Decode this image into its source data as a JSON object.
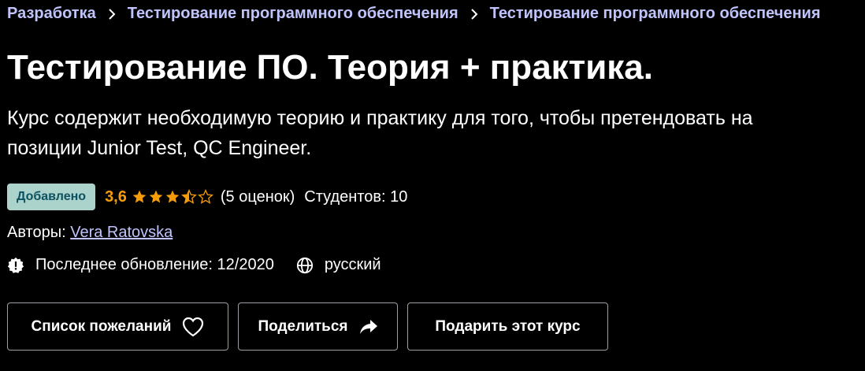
{
  "breadcrumb": {
    "items": [
      "Разработка",
      "Тестирование программного обеспечения",
      "Тестирование программного обеспечения"
    ],
    "separator_icon": "chevron-right-icon"
  },
  "course": {
    "title": "Тестирование ПО. Теория + практика.",
    "subtitle": "Курс содержит необходимую теорию и практику для того, чтобы претендовать на позиции Junior Test, QC Engineer.",
    "badge": "Добавлено",
    "rating_value": "3,6",
    "rating_stars": 3.5,
    "rating_count": "(5 оценок)",
    "students": "Студентов: 10",
    "authors_label": "Авторы: ",
    "author_name": "Vera Ratovska",
    "last_update": "Последнее обновление: 12/2020",
    "language": "русский"
  },
  "actions": {
    "wishlist_label": "Список пожеланий",
    "share_label": "Поделиться",
    "gift_label": "Подарить этот курс"
  },
  "colors": {
    "background": "#000000",
    "link": "#c0c4fc",
    "badge_bg": "#acd2cc",
    "badge_text": "#0d5261",
    "rating": "#f69c08",
    "button_border": "#9ca0a6"
  }
}
